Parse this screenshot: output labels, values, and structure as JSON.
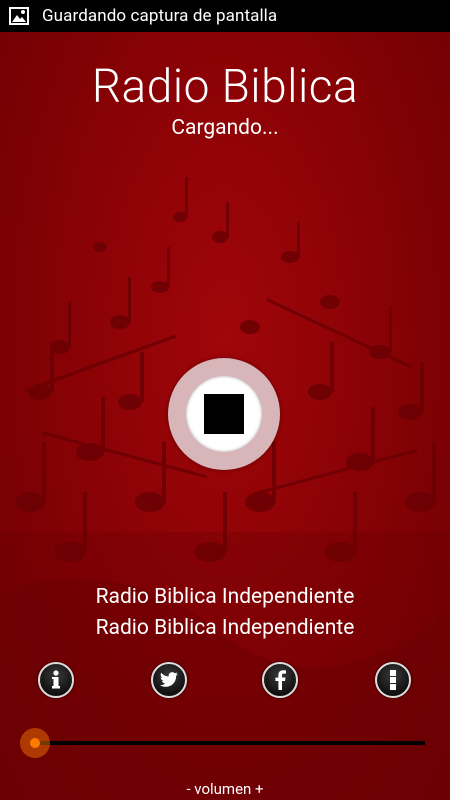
{
  "status_bar": {
    "notification_icon": "image-icon",
    "text": "Guardando captura de pantalla"
  },
  "header": {
    "title": "Radio Biblica",
    "status": "Cargando..."
  },
  "player": {
    "button_icon": "stop-icon"
  },
  "now_playing": {
    "line1": "Radio Biblica Independiente",
    "line2": "Radio Biblica Independiente"
  },
  "actions": [
    {
      "name": "info",
      "icon": "info-icon"
    },
    {
      "name": "twitter",
      "icon": "twitter-icon"
    },
    {
      "name": "facebook",
      "icon": "facebook-icon"
    },
    {
      "name": "menu",
      "icon": "menu-icon"
    }
  ],
  "volume": {
    "label": "- volumen +",
    "level": 0.0,
    "accent_color": "#ff7a00"
  },
  "colors": {
    "background": "#8a0205",
    "status_bar": "#000000",
    "text": "#ffffff"
  }
}
